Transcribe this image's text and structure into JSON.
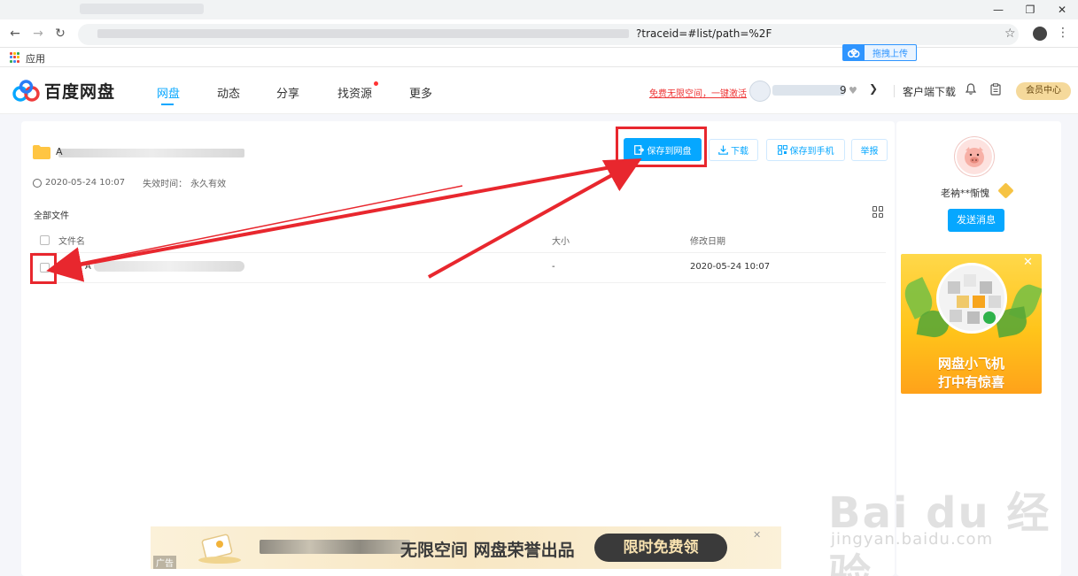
{
  "browser": {
    "address_suffix": "?traceid=#list/path=%2F",
    "bookmark_apps_label": "应用",
    "upload_widget_label": "拖拽上传"
  },
  "header": {
    "logo_text": "百度网盘",
    "nav": [
      {
        "label": "网盘",
        "active": true
      },
      {
        "label": "动态",
        "active": false
      },
      {
        "label": "分享",
        "active": false
      },
      {
        "label": "找资源",
        "active": false
      },
      {
        "label": "更多",
        "active": false
      }
    ],
    "promo_link": "免费无限空间，一键激活",
    "user_suffix": "9",
    "client_download": "客户端下载",
    "member_center": "会员中心"
  },
  "share": {
    "title_initial": "A",
    "created": "2020-05-24 10:07",
    "expire_label": "失效时间：",
    "expire_value": "永久有效",
    "actions": {
      "save_to_disk": "保存到网盘",
      "download": "下载",
      "save_to_phone": "保存到手机",
      "report": "举报"
    }
  },
  "file_list": {
    "breadcrumb": "全部文件",
    "columns": {
      "name": "文件名",
      "size": "大小",
      "modified": "修改日期"
    },
    "rows": [
      {
        "name_initial": "A",
        "size": "-",
        "modified": "2020-05-24 10:07"
      }
    ]
  },
  "sidebar": {
    "username": "老衲**惭愧",
    "send_message": "发送消息",
    "ad_line1": "网盘小飞机",
    "ad_line2": "打中有惊喜"
  },
  "banner": {
    "ad_tag": "广告",
    "text": "无限空间 网盘荣誉出品",
    "cta": "限时免费领"
  },
  "colors": {
    "accent": "#06a7ff",
    "highlight": "#e8272e",
    "member": "#f5d99b"
  },
  "watermark": {
    "brand": "Bai du 经验",
    "url": "jingyan.baidu.com"
  }
}
